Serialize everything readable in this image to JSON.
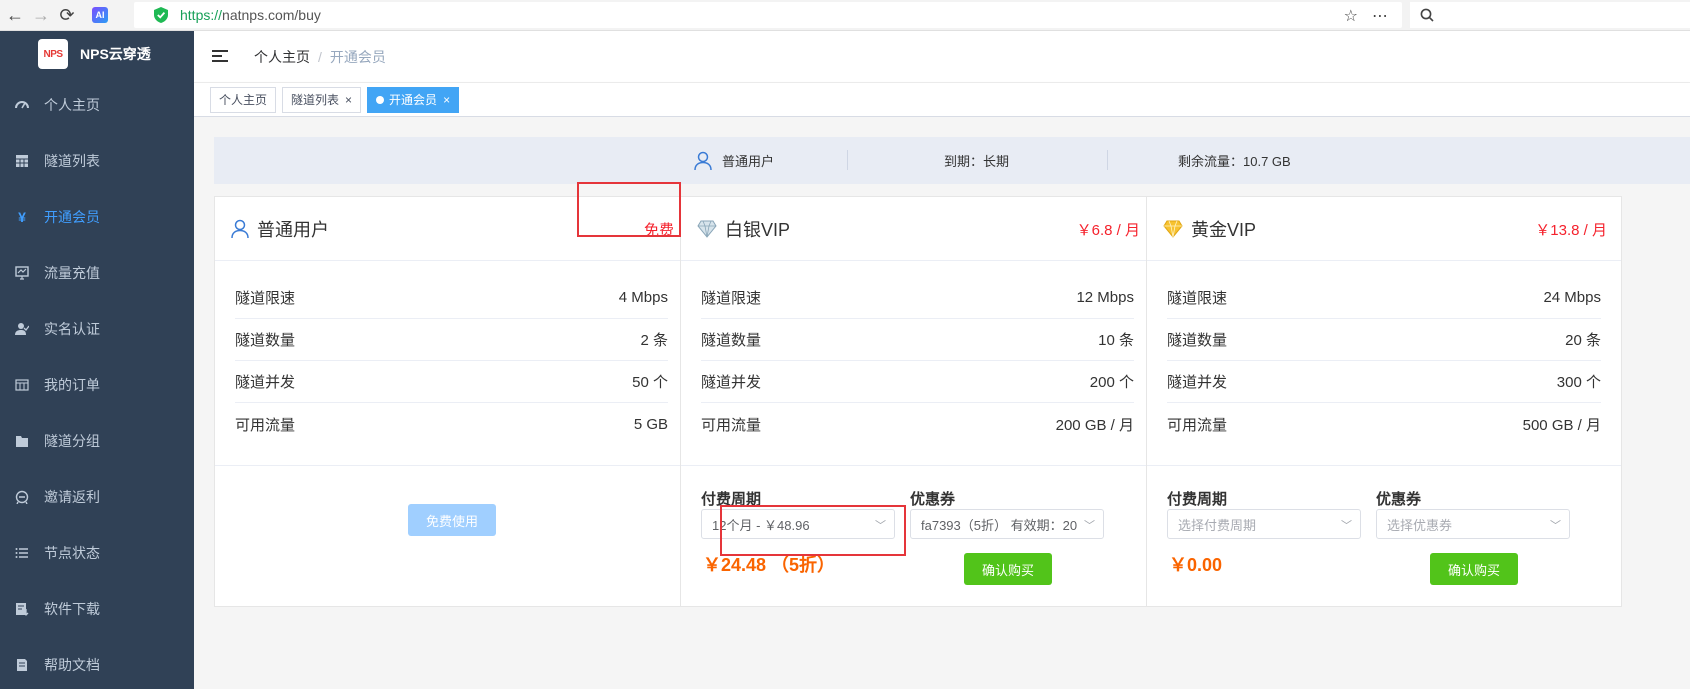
{
  "browser": {
    "url_scheme": "https://",
    "url_rest": "natnps.com/buy",
    "ai_badge": "AI"
  },
  "brand": {
    "logo": "NPS",
    "name": "NPS云穿透"
  },
  "sidebar": {
    "items": [
      {
        "label": "个人主页",
        "icon": "dashboard-icon"
      },
      {
        "label": "隧道列表",
        "icon": "table-icon"
      },
      {
        "label": "开通会员",
        "icon": "yen-icon",
        "active": true
      },
      {
        "label": "流量充值",
        "icon": "monitor-icon"
      },
      {
        "label": "实名认证",
        "icon": "user-verify-icon"
      },
      {
        "label": "我的订单",
        "icon": "order-icon"
      },
      {
        "label": "隧道分组",
        "icon": "folder-icon"
      },
      {
        "label": "邀请返利",
        "icon": "gift-icon"
      },
      {
        "label": "节点状态",
        "icon": "list-icon"
      },
      {
        "label": "软件下载",
        "icon": "download-icon"
      },
      {
        "label": "帮助文档",
        "icon": "docs-icon"
      }
    ]
  },
  "breadcrumb": {
    "home": "个人主页",
    "sep": "/",
    "current": "开通会员"
  },
  "tags": [
    {
      "label": "个人主页"
    },
    {
      "label": "隧道列表",
      "close": "×"
    },
    {
      "label": "开通会员",
      "close": "×",
      "active": true
    }
  ],
  "status": {
    "user_type": "普通用户",
    "expire": "到期：长期",
    "traffic": "剩余流量：10.7 GB"
  },
  "plans": [
    {
      "title": "普通用户",
      "price": "免费",
      "specs": [
        {
          "label": "隧道限速",
          "value": "4 Mbps"
        },
        {
          "label": "隧道数量",
          "value": "2 条"
        },
        {
          "label": "隧道并发",
          "value": "50 个"
        },
        {
          "label": "可用流量",
          "value": "5 GB"
        }
      ],
      "button": "免费使用"
    },
    {
      "title": "白银VIP",
      "price": "￥6.8 / 月",
      "specs": [
        {
          "label": "隧道限速",
          "value": "12 Mbps"
        },
        {
          "label": "隧道数量",
          "value": "10 条"
        },
        {
          "label": "隧道并发",
          "value": "200 个"
        },
        {
          "label": "可用流量",
          "value": "200 GB / 月"
        }
      ],
      "period_label": "付费周期",
      "period_value": "12个月 - ￥48.96",
      "coupon_label": "优惠券",
      "coupon_value": "fa7393（5折） 有效期：20",
      "total": "￥24.48 （5折）",
      "button": "确认购买"
    },
    {
      "title": "黄金VIP",
      "price": "￥13.8 / 月",
      "specs": [
        {
          "label": "隧道限速",
          "value": "24 Mbps"
        },
        {
          "label": "隧道数量",
          "value": "20 条"
        },
        {
          "label": "隧道并发",
          "value": "300 个"
        },
        {
          "label": "可用流量",
          "value": "500 GB / 月"
        }
      ],
      "period_label": "付费周期",
      "period_placeholder": "选择付费周期",
      "coupon_label": "优惠券",
      "coupon_placeholder": "选择优惠券",
      "total": "￥0.00",
      "button": "确认购买"
    }
  ],
  "colors": {
    "sidebar_bg": "#304156",
    "active": "#409eff",
    "price_red": "#f5222d",
    "total_orange": "#fa6400",
    "buy_green": "#52c41a",
    "highlight_red": "#e5353a"
  }
}
